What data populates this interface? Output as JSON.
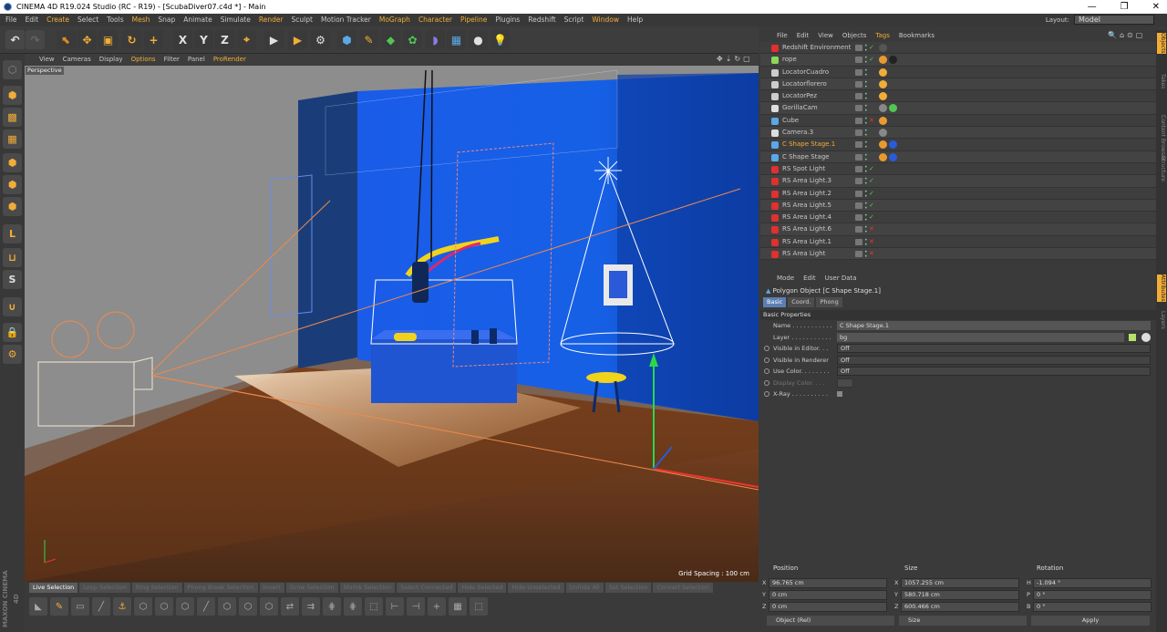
{
  "window": {
    "title": "CINEMA 4D R19.024 Studio (RC - R19) - [ScubaDiver07.c4d *] - Main",
    "controls": [
      "—",
      "❐",
      "✕"
    ]
  },
  "menu": [
    "File",
    "Edit",
    "Create",
    "Select",
    "Tools",
    "Mesh",
    "Snap",
    "Animate",
    "Simulate",
    "Render",
    "Sculpt",
    "Motion Tracker",
    "MoGraph",
    "Character",
    "Pipeline",
    "Plugins",
    "Redshift",
    "Script",
    "Window",
    "Help"
  ],
  "menu_highlight": [
    "Create",
    "Render",
    "Mesh",
    "MoGraph",
    "Character",
    "Pipeline",
    "Window"
  ],
  "layout": {
    "label": "Layout:",
    "value": "Model"
  },
  "toolbar_icons": [
    {
      "name": "undo-icon",
      "glyph": "↶",
      "color": "#e0e0e0",
      "bg": "#474747"
    },
    {
      "name": "redo-icon",
      "glyph": "↷",
      "color": "#666",
      "bg": "#474747"
    },
    {
      "name": "select-live-icon",
      "glyph": "⬉",
      "color": "#e08a20",
      "bg": "#3a3a3a"
    },
    {
      "name": "move-icon",
      "glyph": "✥",
      "color": "#f1ad38",
      "bg": "#3a3a3a"
    },
    {
      "name": "scale-icon",
      "glyph": "▣",
      "color": "#f1ad38",
      "bg": "#3a3a3a"
    },
    {
      "name": "rotate-icon",
      "glyph": "↻",
      "color": "#f1ad38",
      "bg": "#3a3a3a"
    },
    {
      "name": "add-icon",
      "glyph": "+",
      "color": "#f1ad38",
      "bg": "#3a3a3a"
    },
    {
      "name": "x-axis-icon",
      "glyph": "X",
      "color": "#e0e0e0",
      "bg": "#3a3a3a"
    },
    {
      "name": "y-axis-icon",
      "glyph": "Y",
      "color": "#e0e0e0",
      "bg": "#3a3a3a"
    },
    {
      "name": "z-axis-icon",
      "glyph": "Z",
      "color": "#e0e0e0",
      "bg": "#3a3a3a"
    },
    {
      "name": "coord-system-icon",
      "glyph": "⌖",
      "color": "#f1ad38",
      "bg": "#3a3a3a"
    },
    {
      "name": "render-view-icon",
      "glyph": "▶",
      "color": "#e0e0e0",
      "bg": "#3a3a3a"
    },
    {
      "name": "render-picture-icon",
      "glyph": "▶",
      "color": "#f1ad38",
      "bg": "#3a3a3a"
    },
    {
      "name": "render-settings-icon",
      "glyph": "⚙",
      "color": "#e0e0e0",
      "bg": "#3a3a3a"
    },
    {
      "name": "cube-icon",
      "glyph": "⬢",
      "color": "#5aa8e8",
      "bg": "#3a3a3a"
    },
    {
      "name": "pen-icon",
      "glyph": "✎",
      "color": "#f1ad38",
      "bg": "#3a3a3a"
    },
    {
      "name": "subdivision-icon",
      "glyph": "◆",
      "color": "#52c552",
      "bg": "#3a3a3a"
    },
    {
      "name": "mograph-icon",
      "glyph": "✿",
      "color": "#52c552",
      "bg": "#3a3a3a"
    },
    {
      "name": "deformer-icon",
      "glyph": "◗",
      "color": "#8a7ae8",
      "bg": "#3a3a3a"
    },
    {
      "name": "floor-icon",
      "glyph": "▦",
      "color": "#5aa8e8",
      "bg": "#3a3a3a"
    },
    {
      "name": "camera-icon",
      "glyph": "●",
      "color": "#e0e0e0",
      "bg": "#3a3a3a"
    },
    {
      "name": "light-icon",
      "glyph": "💡",
      "color": "#e0e0e0",
      "bg": "#3a3a3a"
    }
  ],
  "left_tools": [
    {
      "name": "make-editable-icon",
      "glyph": "⬡",
      "color": "#888"
    },
    {
      "name": "model-mode-icon",
      "glyph": "⬢",
      "color": "#f1ad38"
    },
    {
      "name": "texture-mode-icon",
      "glyph": "▩",
      "color": "#f1ad38"
    },
    {
      "name": "workplane-icon",
      "glyph": "▦",
      "color": "#f1ad38"
    },
    {
      "name": "points-mode-icon",
      "glyph": "⬢",
      "color": "#f1ad38"
    },
    {
      "name": "edges-mode-icon",
      "glyph": "⬢",
      "color": "#f1ad38"
    },
    {
      "name": "polygons-mode-icon",
      "glyph": "⬢",
      "color": "#f1ad38"
    },
    {
      "name": "axis-mode-icon",
      "glyph": "L",
      "color": "#f1ad38"
    },
    {
      "name": "tweak-mode-icon",
      "glyph": "⊔",
      "color": "#f1ad38"
    },
    {
      "name": "snap-icon",
      "glyph": "S",
      "color": "#e0e0e0"
    },
    {
      "name": "magnet-icon",
      "glyph": "∪",
      "color": "#f1ad38"
    },
    {
      "name": "lock-icon",
      "glyph": "🔒",
      "color": "#e0e0e0"
    },
    {
      "name": "symmetry-icon",
      "glyph": "⚙",
      "color": "#f1ad38"
    }
  ],
  "viewport": {
    "menu": [
      "View",
      "Cameras",
      "Display",
      "Options",
      "Filter",
      "Panel",
      "ProRender"
    ],
    "menu_highlight": [
      "Options",
      "ProRender"
    ],
    "label": "Perspective",
    "grid_spacing": "Grid Spacing : 100 cm",
    "nav_icons": [
      "move-view-icon",
      "zoom-view-icon",
      "rotate-view-icon",
      "maximize-view-icon"
    ]
  },
  "selection_modes": [
    {
      "label": "Live Selection",
      "active": true
    },
    {
      "label": "Loop Selection",
      "active": false
    },
    {
      "label": "Ring Selection",
      "active": false
    },
    {
      "label": "Phong Break Selection",
      "active": false
    },
    {
      "label": "Invert",
      "active": false
    },
    {
      "label": "Grow Selection",
      "active": false
    },
    {
      "label": "Shrink Selection",
      "active": false
    },
    {
      "label": "Select Connected",
      "active": false
    },
    {
      "label": "Hide Selected",
      "active": false
    },
    {
      "label": "Hide Unselected",
      "active": false
    },
    {
      "label": "Unhide All",
      "active": false
    },
    {
      "label": "Set Selection",
      "active": false
    },
    {
      "label": "Convert Selection",
      "active": false
    }
  ],
  "maxon_brand": "MAXON CINEMA 4D",
  "objects_panel": {
    "menu": [
      "File",
      "Edit",
      "View",
      "Objects",
      "Tags",
      "Bookmarks"
    ],
    "menu_highlight": "Tags",
    "rows": [
      {
        "name": "Redshift Environment",
        "icon_color": "#e03030",
        "check": "✓",
        "check_color": "#5c5",
        "tags": [
          "#555"
        ]
      },
      {
        "name": "rope",
        "icon_color": "#8cd858",
        "check": "✓",
        "check_color": "#5c5",
        "tags": [
          "#e89a30",
          "#222"
        ]
      },
      {
        "name": "LocatorCuadro",
        "icon_color": "#ccc",
        "check": "",
        "check_color": "#5c5",
        "tags": [
          "#f1ad38"
        ]
      },
      {
        "name": "Locatorflorero",
        "icon_color": "#ccc",
        "check": "",
        "check_color": "#5c5",
        "tags": [
          "#f1ad38"
        ]
      },
      {
        "name": "LocatorPez",
        "icon_color": "#ccc",
        "check": "",
        "check_color": "#5c5",
        "tags": [
          "#f1ad38"
        ]
      },
      {
        "name": "GorillaCam",
        "icon_color": "#ddd",
        "check": "",
        "check_color": "#5c5",
        "tags": [
          "#888",
          "#52c552"
        ]
      },
      {
        "name": "Cube",
        "icon_color": "#5aa8e8",
        "check": "✕",
        "check_color": "#e33",
        "tags": [
          "#e89a30"
        ]
      },
      {
        "name": "Camera.3",
        "icon_color": "#ddd",
        "check": "",
        "check_color": "#5c5",
        "tags": [
          "#888"
        ]
      },
      {
        "name": "C Shape Stage.1",
        "icon_color": "#5aa8e8",
        "check": "",
        "check_color": "#5c5",
        "tags": [
          "#e89a30",
          "#2a5bd8"
        ],
        "selected": true
      },
      {
        "name": "C Shape Stage",
        "icon_color": "#5aa8e8",
        "check": "",
        "check_color": "#5c5",
        "tags": [
          "#e89a30",
          "#2a5bd8"
        ]
      },
      {
        "name": "RS Spot Light",
        "icon_color": "#e03030",
        "check": "✓",
        "check_color": "#5c5",
        "tags": []
      },
      {
        "name": "RS Area Light.3",
        "icon_color": "#e03030",
        "check": "✓",
        "check_color": "#5c5",
        "tags": []
      },
      {
        "name": "RS Area Light.2",
        "icon_color": "#e03030",
        "check": "✓",
        "check_color": "#5c5",
        "tags": []
      },
      {
        "name": "RS Area Light.5",
        "icon_color": "#e03030",
        "check": "✓",
        "check_color": "#5c5",
        "tags": []
      },
      {
        "name": "RS Area Light.4",
        "icon_color": "#e03030",
        "check": "✓",
        "check_color": "#5c5",
        "tags": []
      },
      {
        "name": "RS Area Light.6",
        "icon_color": "#e03030",
        "check": "✕",
        "check_color": "#e33",
        "tags": []
      },
      {
        "name": "RS Area Light.1",
        "icon_color": "#e03030",
        "check": "✕",
        "check_color": "#e33",
        "tags": []
      },
      {
        "name": "RS Area Light",
        "icon_color": "#e03030",
        "check": "✕",
        "check_color": "#e33",
        "tags": []
      }
    ]
  },
  "right_tabs": [
    "Objects",
    "Takes",
    "Content Browser",
    "Structure"
  ],
  "right_tabs2": [
    "Attributes",
    "Layers"
  ],
  "attributes": {
    "menu": [
      "Mode",
      "Edit",
      "User Data"
    ],
    "title": "Polygon Object [C Shape Stage.1]",
    "tabs": [
      "Basic",
      "Coord.",
      "Phong"
    ],
    "active_tab": "Basic",
    "section": "Basic Properties",
    "props": [
      {
        "label": "Name . . . . . . . . . . .",
        "value": "C Shape Stage.1",
        "type": "text"
      },
      {
        "label": "Layer . . . . . . . . . . .",
        "value": "bg",
        "type": "layer"
      },
      {
        "label": "Visible in Editor. . .",
        "value": "Off",
        "type": "dropdown"
      },
      {
        "label": "Visible in Renderer",
        "value": "Off",
        "type": "dropdown"
      },
      {
        "label": "Use Color. . . . . . . .",
        "value": "Off",
        "type": "dropdown"
      },
      {
        "label": "Display Color. . . .",
        "value": "",
        "type": "color",
        "dim": true
      },
      {
        "label": "X-Ray . . . . . . . . . .",
        "value": "",
        "type": "check"
      }
    ]
  },
  "coordinates": {
    "headers": [
      "Position",
      "Size",
      "Rotation"
    ],
    "rows": [
      {
        "axis": "X",
        "pos": "96.765 cm",
        "saxis": "X",
        "size": "1057.255 cm",
        "raxis": "H",
        "rot": "-1.094 °"
      },
      {
        "axis": "Y",
        "pos": "0 cm",
        "saxis": "Y",
        "size": "580.718 cm",
        "raxis": "P",
        "rot": "0 °"
      },
      {
        "axis": "Z",
        "pos": "0 cm",
        "saxis": "Z",
        "size": "600.466 cm",
        "raxis": "B",
        "rot": "0 °"
      }
    ],
    "mode": "Object (Rel)",
    "size_mode": "Size",
    "apply": "Apply"
  }
}
